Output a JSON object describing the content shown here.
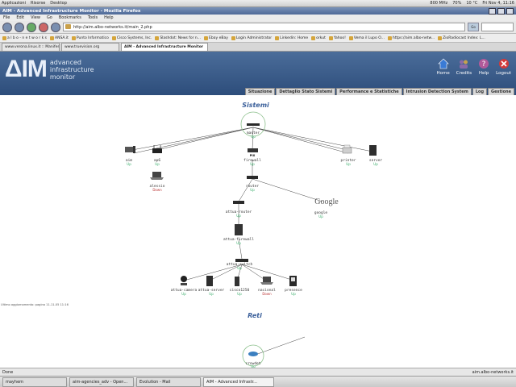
{
  "gnome_panel": {
    "menus": [
      "Applicazioni",
      "Risorse",
      "Desktop"
    ],
    "clock": "Fri Nov 4, 11:16",
    "cpu": "800 MHz",
    "battery": "70%",
    "temp": "10 °C"
  },
  "window": {
    "title": "AIM - Advanced Infrastructure Monitor - Mozilla Firefox"
  },
  "menubar": [
    "File",
    "Edit",
    "View",
    "Go",
    "Bookmarks",
    "Tools",
    "Help"
  ],
  "navbar": {
    "url": "http://aim.albo-networks.it/main_2.php",
    "go_label": "Go"
  },
  "bookmarks": [
    "a l b o - n e t w o r k s",
    "ANSA.it",
    "Punto Informatico",
    "Cisco Systems, Inc.",
    "Slashdot: News for n...",
    "Ebay eBay",
    "Login Administrator",
    "Linkedin: Home",
    "orkut",
    "Yahoo!",
    "Vema il Lupo O...",
    "https://aim.albo-netw...",
    "ZioRadiocast Index: L..."
  ],
  "tabs": [
    "www.verona.linux.it :: Manifesti@blog",
    "www.truevision.org",
    "AIM - Advanced Infrastructure Monitor"
  ],
  "aim": {
    "logo": "ΔIM",
    "logo_sub": [
      "advanced",
      "infrastructure",
      "monitor"
    ],
    "icons": [
      {
        "label": "Home",
        "icon": "home-icon",
        "color": "#3a7bd5"
      },
      {
        "label": "Credits",
        "icon": "credits-icon",
        "color": "#8a6aa8"
      },
      {
        "label": "Help",
        "icon": "help-icon",
        "color": "#b05a9a"
      },
      {
        "label": "Logout",
        "icon": "logout-icon",
        "color": "#d23a3a"
      }
    ],
    "nav": [
      "Situazione",
      "Dettaglio Stato Sistemi",
      "Performance e Statistiche",
      "Intrusion Detection System",
      "Log",
      "Gestione"
    ]
  },
  "diagram": {
    "section_systems": "Sistemi",
    "section_networks": "Reti",
    "update_note": "Ultimo aggiornamento: pagina 11-11-05 11:16",
    "nodes": {
      "master": {
        "label": "master",
        "status": "Up"
      },
      "aim": {
        "label": "aim",
        "status": "Up"
      },
      "ap6": {
        "label": "ap6",
        "status": "Up"
      },
      "firewall": {
        "label": "firewall",
        "status": "Up"
      },
      "printer": {
        "label": "printer",
        "status": "Up"
      },
      "server": {
        "label": "server",
        "status": "Up"
      },
      "alessio": {
        "label": "alessio",
        "status": "Down"
      },
      "router": {
        "label": "router",
        "status": "Up"
      },
      "google": {
        "label": "google",
        "status": "Up",
        "logo": "Google"
      },
      "attua_router": {
        "label": "attua-router",
        "status": "Up"
      },
      "attua_firewall": {
        "label": "attua-firewall",
        "status": "Up"
      },
      "attua_switch": {
        "label": "attua-switch",
        "status": "Up"
      },
      "attua_camera": {
        "label": "attua-camera",
        "status": "Up"
      },
      "attua_server": {
        "label": "attua-server",
        "status": "Up"
      },
      "cisco": {
        "label": "cisco1250",
        "status": "Up"
      },
      "nacional": {
        "label": "nacional",
        "status": "Down"
      },
      "presence": {
        "label": "presence",
        "status": "Up"
      },
      "crowdet": {
        "label": "crowdet",
        "status": "Up"
      }
    }
  },
  "statusbar": {
    "left": "Done",
    "right": "aim.albo-networks.it"
  },
  "taskbar": [
    "mayhem",
    "aim-agencies_adv - Open...",
    "Evolution - Mail",
    "AIM - Advanced Infrastr..."
  ]
}
